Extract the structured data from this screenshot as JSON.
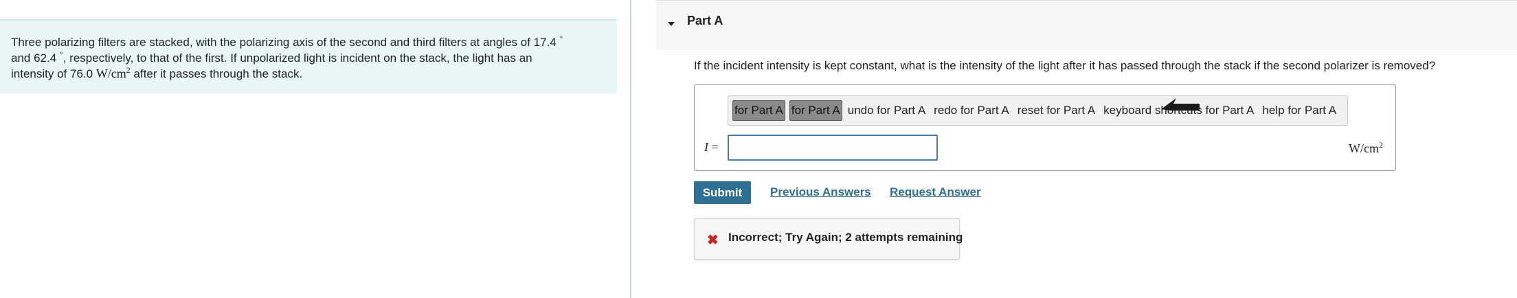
{
  "problem": {
    "line1": "Three polarizing filters are stacked, with the polarizing axis of the second and third filters at angles of 17.4",
    "degree_symbol": "°",
    "line2_a": "and 62.4",
    "line2_b": ", respectively, to that of the first. If unpolarized light is incident on the stack, the light has an",
    "line3_a": "intensity of 76.0",
    "unit_base": "W/cm",
    "unit_exp": "2",
    "line3_b": " after it passes through the stack."
  },
  "part": {
    "title": "Part A",
    "question": "If the incident intensity is kept constant, what is the intensity of the light after it has passed through the stack if the second polarizer is removed?"
  },
  "toolbar": {
    "btn1": "for Part A",
    "btn2": "for Part A",
    "undo": "undo for Part A",
    "redo": "redo for Part A",
    "reset": "reset for Part A",
    "keyboard": "keyboard shortcuts for Part A",
    "help": "help for Part A"
  },
  "answer": {
    "variable": "I",
    "equals": "=",
    "value": "",
    "unit_base": "W/cm",
    "unit_exp": "2"
  },
  "actions": {
    "submit": "Submit",
    "previous_answers": "Previous Answers",
    "request_answer": "Request Answer"
  },
  "feedback": {
    "icon": "x-icon",
    "text": "Incorrect; Try Again; 2 attempts remaining"
  },
  "colors": {
    "accent": "#2f6f94",
    "problem_bg": "#e8f6f6",
    "error": "#cc2222"
  }
}
